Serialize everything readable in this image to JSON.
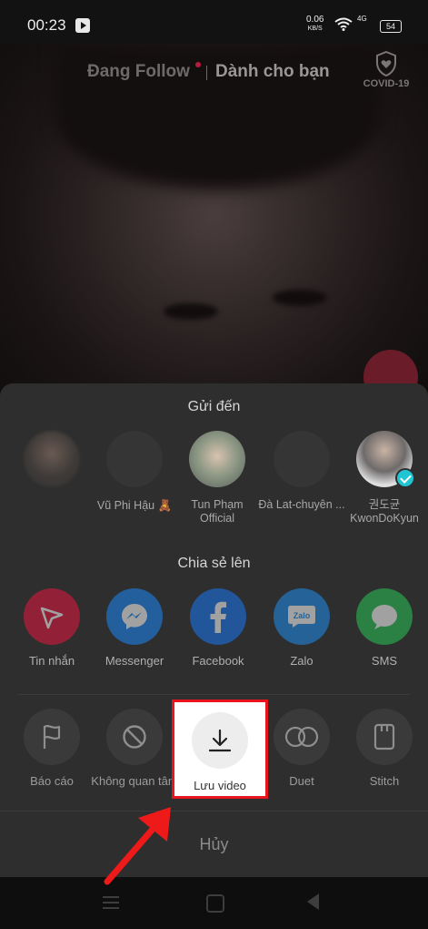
{
  "status_bar": {
    "time": "00:23",
    "speed_value": "0.06",
    "speed_unit": "KB/S",
    "network": "4G",
    "battery": "54"
  },
  "feed": {
    "tab_following": "Đang Follow",
    "tab_for_you": "Dành cho bạn",
    "covid_label": "COVID-19"
  },
  "share_sheet": {
    "send_to_title": "Gửi đến",
    "contacts": [
      {
        "name": ""
      },
      {
        "name": "Vũ Phi Hậu 🧸"
      },
      {
        "name": "Tun Phạm Official"
      },
      {
        "name": "Đà Lat-chuyên ..."
      },
      {
        "name": "권도균 KwonDoKyun"
      }
    ],
    "share_to_title": "Chia sẻ lên",
    "apps": [
      {
        "label": "Tin nhắn",
        "icon": "send-icon",
        "color": "#e5173f"
      },
      {
        "label": "Messenger",
        "icon": "messenger-icon",
        "color": "#1b86f9"
      },
      {
        "label": "Facebook",
        "icon": "facebook-icon",
        "color": "#1977f3"
      },
      {
        "label": "Zalo",
        "icon": "zalo-icon",
        "color": "#1f8ef0"
      },
      {
        "label": "SMS",
        "icon": "chat-bubble-icon",
        "color": "#29c455"
      }
    ],
    "actions": [
      {
        "label": "Báo cáo",
        "icon": "flag-icon"
      },
      {
        "label": "Không quan tâm",
        "icon": "not-interested-icon"
      },
      {
        "label": "Lưu video",
        "icon": "download-icon"
      },
      {
        "label": "Duet",
        "icon": "duet-icon"
      },
      {
        "label": "Stitch",
        "icon": "stitch-icon"
      }
    ],
    "cancel_label": "Hủy"
  },
  "highlight_color": "#e8141e"
}
